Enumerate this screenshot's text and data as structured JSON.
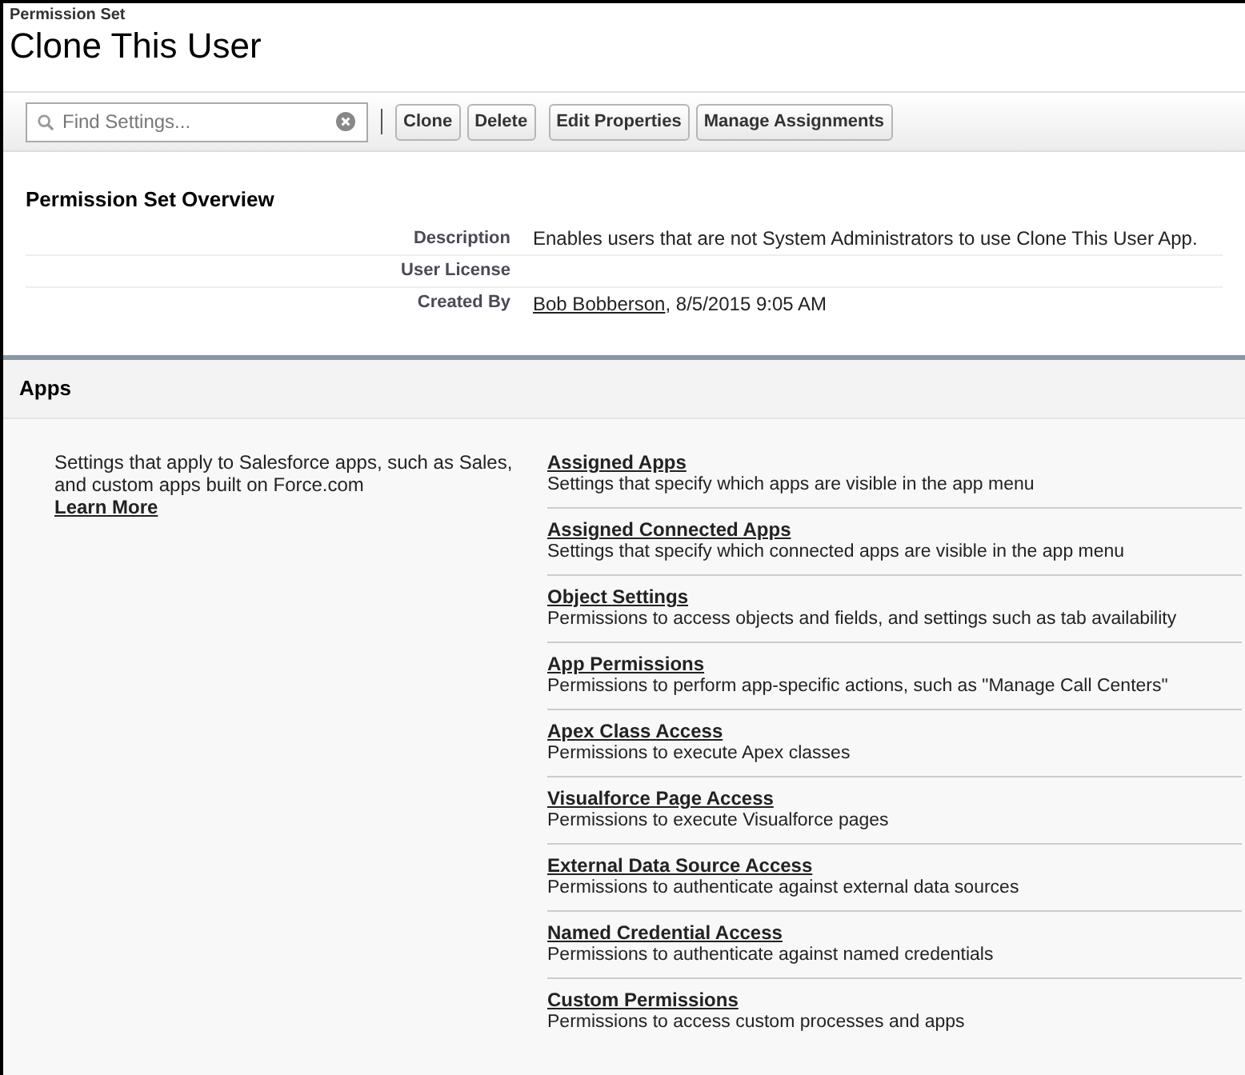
{
  "header": {
    "type_label": "Permission Set",
    "title": "Clone This User"
  },
  "toolbar": {
    "search": {
      "placeholder": "Find Settings..."
    },
    "buttons": [
      "Clone",
      "Delete",
      "Edit Properties",
      "Manage Assignments"
    ]
  },
  "overview": {
    "title": "Permission Set Overview",
    "fields": [
      {
        "label": "Description",
        "value": "Enables users that are not System Administrators to use Clone This User App."
      },
      {
        "label": "User License"
      },
      {
        "label": "Created By",
        "link": "Bob Bobberson",
        "value": ", 8/5/2015 9:05 AM"
      }
    ]
  },
  "apps": {
    "title": "Apps",
    "intro": "Settings that apply to Salesforce apps, such as Sales, and custom apps built on Force.com",
    "learn_more": "Learn More",
    "items": [
      {
        "title": "Assigned Apps",
        "description": "Settings that specify which apps are visible in the app menu"
      },
      {
        "title": "Assigned Connected Apps",
        "description": "Settings that specify which connected apps are visible in the app menu"
      },
      {
        "title": "Object Settings",
        "description": "Permissions to access objects and fields, and settings such as tab availability"
      },
      {
        "title": "App Permissions",
        "description": "Permissions to perform app-specific actions, such as \"Manage Call Centers\""
      },
      {
        "title": "Apex Class Access",
        "description": "Permissions to execute Apex classes"
      },
      {
        "title": "Visualforce Page Access",
        "description": "Permissions to execute Visualforce pages"
      },
      {
        "title": "External Data Source Access",
        "description": "Permissions to authenticate against external data sources"
      },
      {
        "title": "Named Credential Access",
        "description": "Permissions to authenticate against named credentials"
      },
      {
        "title": "Custom Permissions",
        "description": "Permissions to access custom processes and apps"
      }
    ]
  }
}
